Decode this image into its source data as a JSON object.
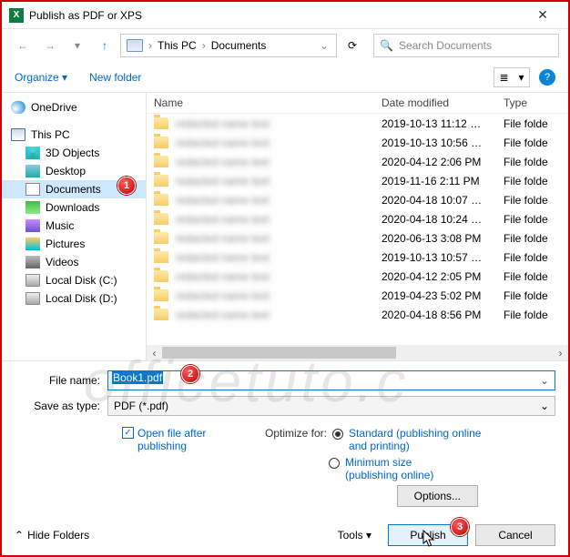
{
  "title": "Publish as PDF or XPS",
  "breadcrumb": {
    "loc1": "This PC",
    "loc2": "Documents"
  },
  "search_placeholder": "Search Documents",
  "toolbar": {
    "organize": "Organize",
    "newfolder": "New folder"
  },
  "tree": {
    "onedrive": "OneDrive",
    "thispc": "This PC",
    "d3": "3D Objects",
    "desktop": "Desktop",
    "documents": "Documents",
    "downloads": "Downloads",
    "music": "Music",
    "pictures": "Pictures",
    "videos": "Videos",
    "diskc": "Local Disk (C:)",
    "diskd": "Local Disk (D:)"
  },
  "headers": {
    "name": "Name",
    "date": "Date modified",
    "type": "Type"
  },
  "files": [
    {
      "date": "2019-10-13 11:12 …",
      "type": "File folde"
    },
    {
      "date": "2019-10-13 10:56 …",
      "type": "File folde"
    },
    {
      "date": "2020-04-12 2:06 PM",
      "type": "File folde"
    },
    {
      "date": "2019-11-16 2:11 PM",
      "type": "File folde"
    },
    {
      "date": "2020-04-18 10:07 …",
      "type": "File folde"
    },
    {
      "date": "2020-04-18 10:24 …",
      "type": "File folde"
    },
    {
      "date": "2020-06-13 3:08 PM",
      "type": "File folde"
    },
    {
      "date": "2019-10-13 10:57 …",
      "type": "File folde"
    },
    {
      "date": "2020-04-12 2:05 PM",
      "type": "File folde"
    },
    {
      "date": "2019-04-23 5:02 PM",
      "type": "File folde"
    },
    {
      "date": "2020-04-18 8:56 PM",
      "type": "File folde"
    }
  ],
  "form": {
    "filename_label": "File name:",
    "filename_value": "Book1.pdf",
    "saveas_label": "Save as type:",
    "saveas_value": "PDF (*.pdf)",
    "openafter": "Open file after publishing",
    "optimize_label": "Optimize for:",
    "standard": "Standard (publishing online and printing)",
    "minimum": "Minimum size (publishing online)",
    "options": "Options..."
  },
  "footer": {
    "hide": "Hide Folders",
    "tools": "Tools",
    "publish": "Publish",
    "cancel": "Cancel"
  },
  "callouts": {
    "c1": "1",
    "c2": "2",
    "c3": "3"
  }
}
